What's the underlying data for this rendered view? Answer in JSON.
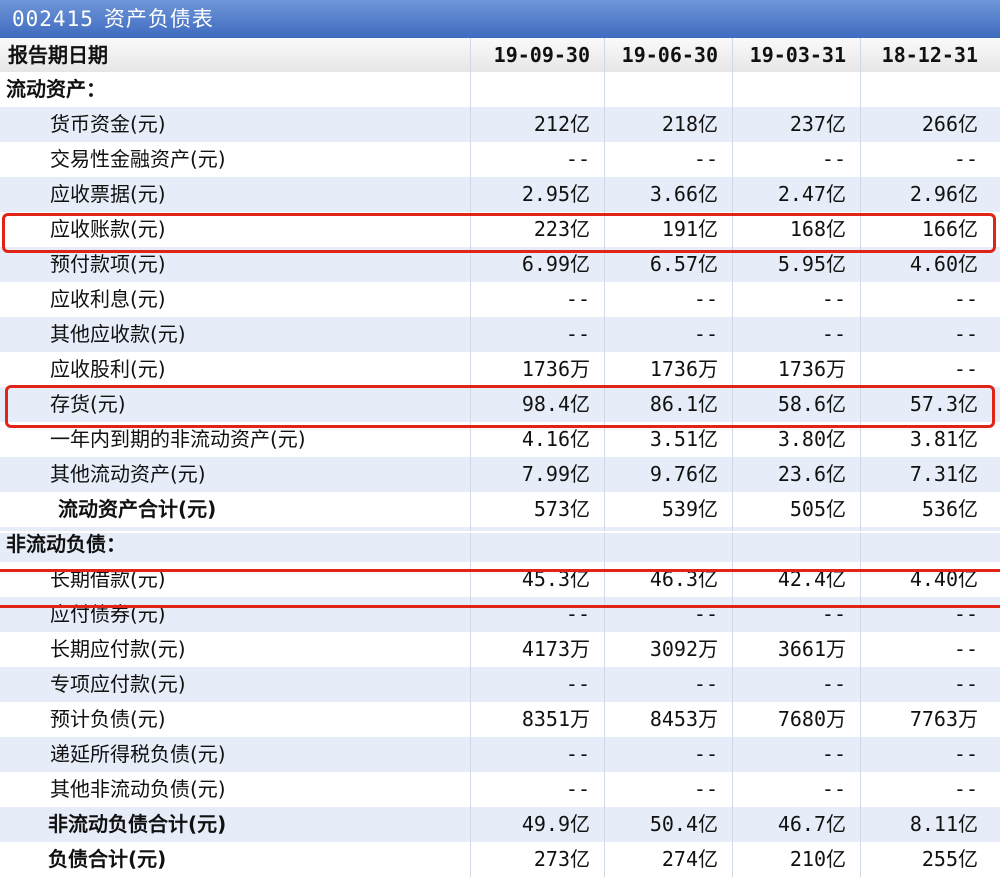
{
  "window": {
    "code": "002415",
    "title": "资产负债表"
  },
  "header": {
    "label": "报告期日期",
    "dates": [
      "19-09-30",
      "19-06-30",
      "19-03-31",
      "18-12-31"
    ]
  },
  "sections": [
    {
      "title": "流动资产：",
      "rows": [
        {
          "label": "货币资金(元)",
          "values": [
            "212亿",
            "218亿",
            "237亿",
            "266亿"
          ]
        },
        {
          "label": "交易性金融资产(元)",
          "values": [
            "--",
            "--",
            "--",
            "--"
          ]
        },
        {
          "label": "应收票据(元)",
          "values": [
            "2.95亿",
            "3.66亿",
            "2.47亿",
            "2.96亿"
          ]
        },
        {
          "label": "应收账款(元)",
          "values": [
            "223亿",
            "191亿",
            "168亿",
            "166亿"
          ]
        },
        {
          "label": "预付款项(元)",
          "values": [
            "6.99亿",
            "6.57亿",
            "5.95亿",
            "4.60亿"
          ]
        },
        {
          "label": "应收利息(元)",
          "values": [
            "--",
            "--",
            "--",
            "--"
          ]
        },
        {
          "label": "其他应收款(元)",
          "values": [
            "--",
            "--",
            "--",
            "--"
          ]
        },
        {
          "label": "应收股利(元)",
          "values": [
            "1736万",
            "1736万",
            "1736万",
            "--"
          ]
        },
        {
          "label": "存货(元)",
          "values": [
            "98.4亿",
            "86.1亿",
            "58.6亿",
            "57.3亿"
          ]
        },
        {
          "label": "一年内到期的非流动资产(元)",
          "values": [
            "4.16亿",
            "3.51亿",
            "3.80亿",
            "3.81亿"
          ]
        },
        {
          "label": "其他流动资产(元)",
          "values": [
            "7.99亿",
            "9.76亿",
            "23.6亿",
            "7.31亿"
          ]
        }
      ],
      "total": {
        "label": "流动资产合计(元)",
        "values": [
          "573亿",
          "539亿",
          "505亿",
          "536亿"
        ]
      }
    },
    {
      "title": "非流动负债：",
      "rows": [
        {
          "label": "长期借款(元)",
          "values": [
            "45.3亿",
            "46.3亿",
            "42.4亿",
            "4.40亿"
          ]
        },
        {
          "label": "应付债券(元)",
          "values": [
            "--",
            "--",
            "--",
            "--"
          ]
        },
        {
          "label": "长期应付款(元)",
          "values": [
            "4173万",
            "3092万",
            "3661万",
            "--"
          ]
        },
        {
          "label": "专项应付款(元)",
          "values": [
            "--",
            "--",
            "--",
            "--"
          ]
        },
        {
          "label": "预计负债(元)",
          "values": [
            "8351万",
            "8453万",
            "7680万",
            "7763万"
          ]
        },
        {
          "label": "递延所得税负债(元)",
          "values": [
            "--",
            "--",
            "--",
            "--"
          ]
        },
        {
          "label": "其他非流动负债(元)",
          "values": [
            "--",
            "--",
            "--",
            "--"
          ]
        }
      ],
      "total": {
        "label": "非流动负债合计(元)",
        "values": [
          "49.9亿",
          "50.4亿",
          "46.7亿",
          "8.11亿"
        ]
      }
    }
  ],
  "grand_total": {
    "label": "负债合计(元)",
    "values": [
      "273亿",
      "274亿",
      "210亿",
      "255亿"
    ]
  },
  "colors": {
    "title_bar": "#4a76c7",
    "row_stripe": "#e7edf8",
    "highlight": "#e02418"
  }
}
